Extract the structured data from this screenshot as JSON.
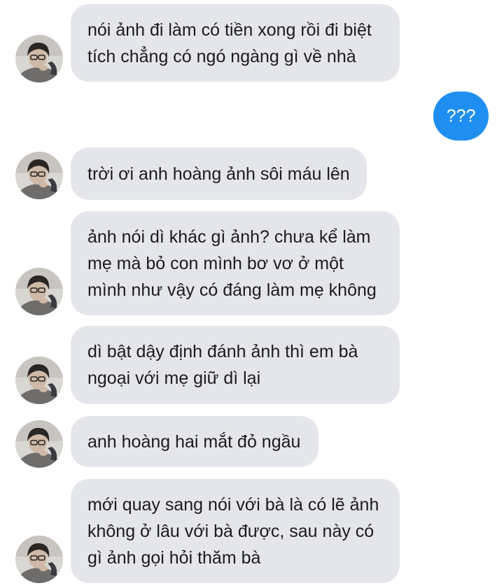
{
  "messages": [
    {
      "type": "incoming",
      "text": "nói ảnh đi làm có tiền xong rồi đi biệt\ntích chẳng có ngó ngàng gì về nhà"
    },
    {
      "type": "outgoing",
      "text": "???"
    },
    {
      "type": "incoming",
      "text": "trời ơi anh hoàng ảnh sôi máu lên"
    },
    {
      "type": "incoming",
      "text": "ảnh nói dì khác gì ảnh? chưa kể làm\nmẹ mà bỏ con mình bơ vơ ở một\nmình như vậy có đáng làm mẹ không"
    },
    {
      "type": "incoming",
      "text": "dì bật dậy định đánh ảnh thì em bà\nngoại với mẹ giữ dì lại"
    },
    {
      "type": "incoming",
      "text": "anh hoàng hai mắt đỏ ngầu"
    },
    {
      "type": "incoming",
      "text": "mới quay sang nói với bà là có lẽ ảnh\nkhông ở lâu với bà được, sau này có\ngì ảnh gọi hỏi thăm bà"
    }
  ],
  "icons": {
    "avatar": "profile-photo-avatar-icon"
  },
  "colors": {
    "incoming_bubble": "#e4e6eb",
    "outgoing_bubble": "#1f8ef1",
    "incoming_text": "#1c1c1c",
    "outgoing_text": "#ffffff"
  }
}
